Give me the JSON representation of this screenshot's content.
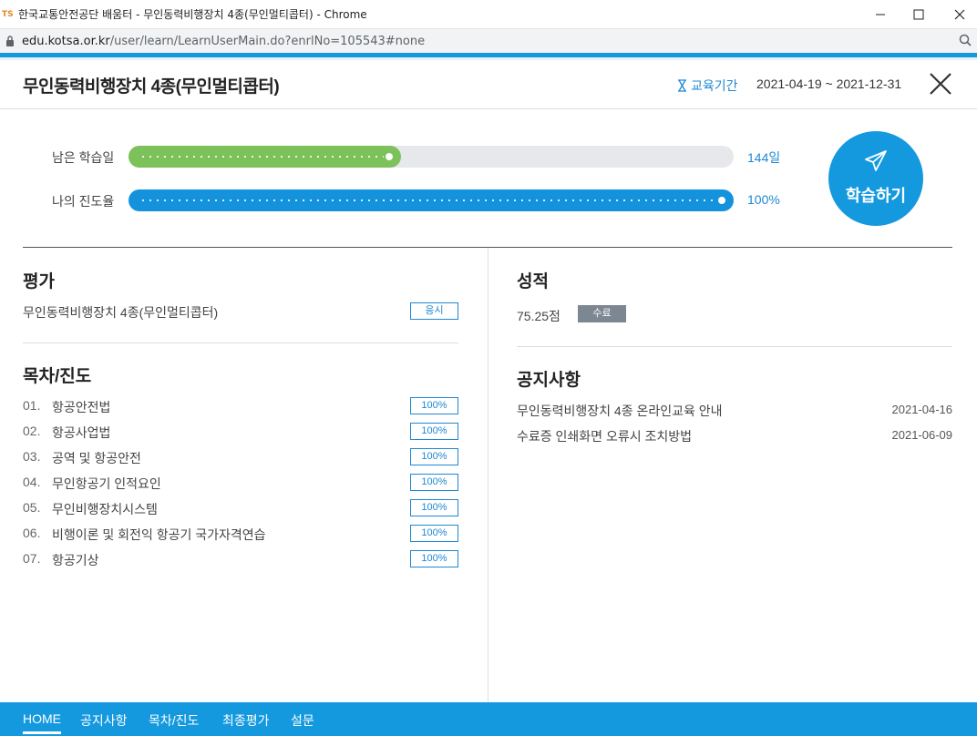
{
  "window": {
    "favicon_text": "TS",
    "title": "한국교통안전공단 배움터 - 무인동력비행장치 4종(무인멀티콥터) - Chrome",
    "url_host": "edu.kotsa.or.kr",
    "url_path": "/user/learn/LearnUserMain.do?enrlNo=105543#none"
  },
  "header": {
    "course_title": "무인동력비행장치 4종(무인멀티콥터)",
    "period_label": "교육기간",
    "period_value": "2021-04-19 ~ 2021-12-31"
  },
  "progress": {
    "remaining_label": "남은 학습일",
    "remaining_value": "144일",
    "remaining_fraction": 0.45,
    "remaining_color": "#7cc15a",
    "my_label": "나의 진도율",
    "my_value": "100%",
    "my_fraction": 1.0,
    "my_color": "#1493dc"
  },
  "study_button": {
    "label": "학습하기"
  },
  "evaluation": {
    "title": "평가",
    "item": "무인동력비행장치 4종(무인멀티콥터)",
    "action": "응시"
  },
  "toc": {
    "title": "목차/진도",
    "items": [
      {
        "num": "01.",
        "name": "항공안전법",
        "progress": "100%"
      },
      {
        "num": "02.",
        "name": "항공사업법",
        "progress": "100%"
      },
      {
        "num": "03.",
        "name": "공역 및 항공안전",
        "progress": "100%"
      },
      {
        "num": "04.",
        "name": "무인항공기 인적요인",
        "progress": "100%"
      },
      {
        "num": "05.",
        "name": "무인비행장치시스템",
        "progress": "100%"
      },
      {
        "num": "06.",
        "name": "비행이론 및 회전익 항공기 국가자격연습",
        "progress": "100%"
      },
      {
        "num": "07.",
        "name": "항공기상",
        "progress": "100%"
      }
    ]
  },
  "grade": {
    "title": "성적",
    "score": "75.25점",
    "status": "수료"
  },
  "notices": {
    "title": "공지사항",
    "items": [
      {
        "title": "무인동력비행장치 4종 온라인교육 안내",
        "date": "2021-04-16"
      },
      {
        "title": "수료증 인쇄화면 오류시 조치방법",
        "date": "2021-06-09"
      }
    ]
  },
  "bottom_nav": [
    "HOME",
    "공지사항",
    "목차/진도",
    "최종평가",
    "설문"
  ],
  "colors": {
    "accent": "#1499df",
    "link": "#1e88d2",
    "green": "#7cc15a",
    "badge_gray": "#7d8793"
  }
}
